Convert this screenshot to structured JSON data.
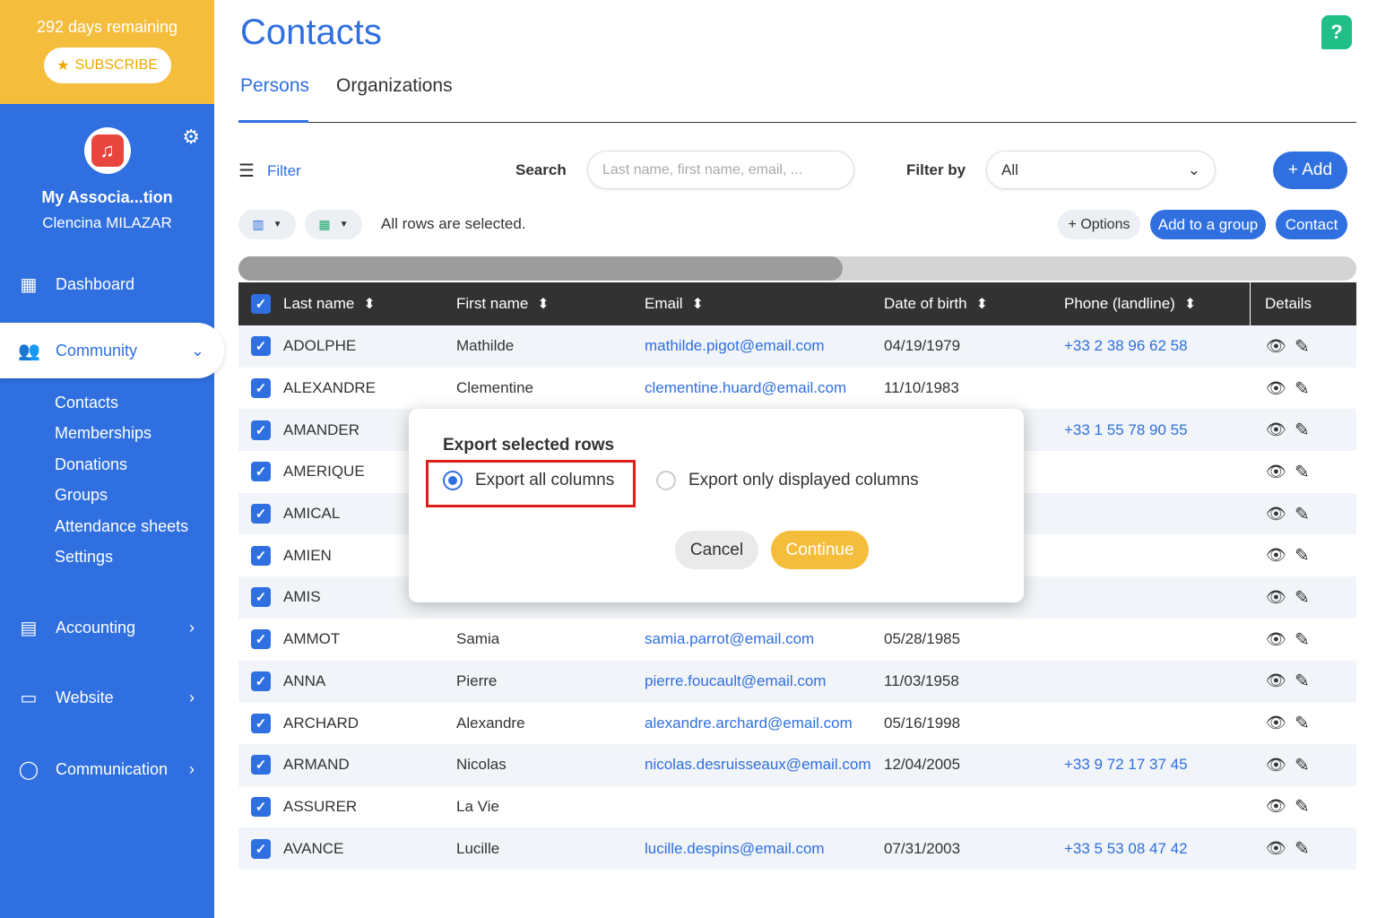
{
  "trial": {
    "days_remaining": "292 days remaining",
    "subscribe_label": "SUBSCRIBE"
  },
  "profile": {
    "org_name": "My Associa...tion",
    "user_name": "Clencina MILAZAR"
  },
  "nav": {
    "dashboard": "Dashboard",
    "community": "Community",
    "community_items": [
      "Contacts",
      "Memberships",
      "Donations",
      "Groups",
      "Attendance sheets",
      "Settings"
    ],
    "accounting": "Accounting",
    "website": "Website",
    "communication": "Communication"
  },
  "page": {
    "title": "Contacts",
    "help": "?"
  },
  "tabs": {
    "persons": "Persons",
    "organizations": "Organizations"
  },
  "toolbar": {
    "filter_label": "Filter",
    "search_label": "Search",
    "search_placeholder": "Last name, first name, email, ...",
    "filterby_label": "Filter by",
    "filterby_value": "All",
    "add_label": "+ Add",
    "selected_text": "All rows are selected.",
    "options_label": "+ Options",
    "add_group_label": "Add to a group",
    "contact_label": "Contact"
  },
  "table": {
    "headers": {
      "last_name": "Last name",
      "first_name": "First name",
      "email": "Email",
      "dob": "Date of birth",
      "phone": "Phone (landline)",
      "details": "Details"
    },
    "rows": [
      {
        "last": "ADOLPHE",
        "first": "Mathilde",
        "email": "mathilde.pigot@email.com",
        "dob": "04/19/1979",
        "phone": "+33 2 38 96 62 58"
      },
      {
        "last": "ALEXANDRE",
        "first": "Clementine",
        "email": "clementine.huard@email.com",
        "dob": "11/10/1983",
        "phone": ""
      },
      {
        "last": "AMANDER",
        "first": "",
        "email": "",
        "dob": "",
        "phone": "+33 1 55 78 90 55"
      },
      {
        "last": "AMERIQUE",
        "first": "",
        "email": "",
        "dob": "",
        "phone": ""
      },
      {
        "last": "AMICAL",
        "first": "",
        "email": "",
        "dob": "",
        "phone": ""
      },
      {
        "last": "AMIEN",
        "first": "",
        "email": "",
        "dob": "",
        "phone": ""
      },
      {
        "last": "AMIS",
        "first": "",
        "email": "",
        "dob": "",
        "phone": ""
      },
      {
        "last": "AMMOT",
        "first": "Samia",
        "email": "samia.parrot@email.com",
        "dob": "05/28/1985",
        "phone": ""
      },
      {
        "last": "ANNA",
        "first": "Pierre",
        "email": "pierre.foucault@email.com",
        "dob": "11/03/1958",
        "phone": ""
      },
      {
        "last": "ARCHARD",
        "first": "Alexandre",
        "email": "alexandre.archard@email.com",
        "dob": "05/16/1998",
        "phone": ""
      },
      {
        "last": "ARMAND",
        "first": "Nicolas",
        "email": "nicolas.desruisseaux@email.com",
        "dob": "12/04/2005",
        "phone": "+33 9 72 17 37 45"
      },
      {
        "last": "ASSURER",
        "first": "La Vie",
        "email": "",
        "dob": "",
        "phone": ""
      },
      {
        "last": "AVANCE",
        "first": "Lucille",
        "email": "lucille.despins@email.com",
        "dob": "07/31/2003",
        "phone": "+33 5 53 08 47 42"
      }
    ]
  },
  "modal": {
    "title": "Export selected rows",
    "option_all": "Export all columns",
    "option_displayed": "Export only displayed columns",
    "selected_option": "all",
    "cancel_label": "Cancel",
    "continue_label": "Continue"
  },
  "colors": {
    "primary": "#2f6fe0",
    "accent": "#f5bd3c",
    "highlight": "#e21b1b",
    "help": "#1fbf87"
  }
}
